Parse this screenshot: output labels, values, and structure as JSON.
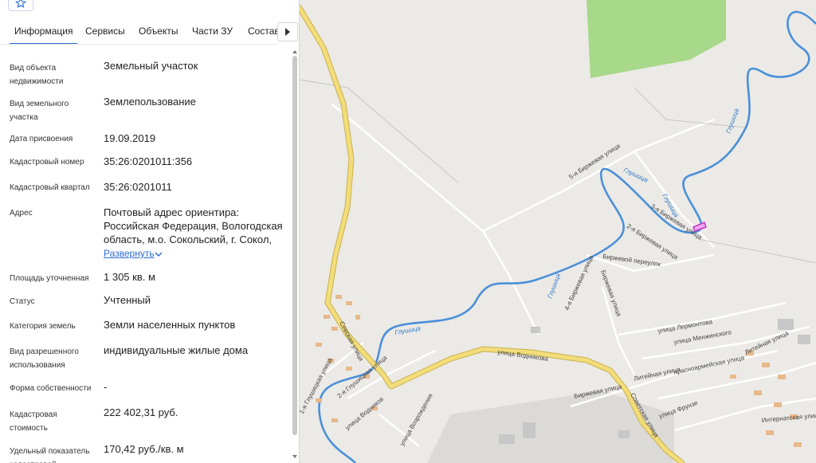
{
  "tabs": [
    "Информация",
    "Сервисы",
    "Объекты",
    "Части ЗУ",
    "Состав"
  ],
  "properties": [
    {
      "label": "Вид объекта недвижимости",
      "value": "Земельный участок"
    },
    {
      "label": "Вид земельного участка",
      "value": "Землепользование"
    },
    {
      "label": "Дата присвоения",
      "value": "19.09.2019"
    },
    {
      "label": "Кадастровый номер",
      "value": "35:26:0201011:356"
    },
    {
      "label": "Кадастровый квартал",
      "value": "35:26:0201011"
    },
    {
      "label": "Адрес",
      "value": "Почтовый адрес ориентира: Российская Федерация, Вологодская область, м.о. Сокольский, г. Сокол,"
    },
    {
      "label": "Площадь уточненная",
      "value": "1 305 кв. м"
    },
    {
      "label": "Статус",
      "value": "Учтенный"
    },
    {
      "label": "Категория земель",
      "value": "Земли населенных пунктов"
    },
    {
      "label": "Вид разрешенного использования",
      "value": "индивидуальные жилые дома"
    },
    {
      "label": "Форма собственности",
      "value": "-"
    },
    {
      "label": "Кадастровая стоимость",
      "value": "222 402,31 руб."
    },
    {
      "label": "Удельный показатель кадастровой",
      "value": "170,42 руб./кв. м"
    }
  ],
  "address_expand": "Развернуть",
  "map": {
    "streets": {
      "vodnikov": "улица Водникова",
      "sovetskaya": "Советская улица",
      "sevskaya": "Севская улица",
      "birzhevaya5": "5-я Биржевая улица",
      "birzhevaya3": "3-я Биржевая улица",
      "birzhevaya2": "2-я Биржевая улица",
      "birzhevaya4": "4-я Биржевая улица",
      "birzhevaya_ul": "Биржевая улица",
      "birzhevaya_ul2": "Биржевая улица",
      "birzhevoy_per": "Биржевой переулок",
      "lermontova": "улица Лермонтова",
      "menzhinskogo": "улица Менжинского",
      "krasnoarmeyskaya": "Красноармейская улица",
      "liteynaya": "Литейная улица",
      "liteynaya2": "Литейная улица",
      "frunze": "улица Фрунзе",
      "internatskaya": "Интернатская улица",
      "glushitskaya1": "1-я Глушицкая улица",
      "glushitskaya2": "2-я Глушицкая улица",
      "vodnikov2": "улица Водников",
      "vozrozhdeniya": "улица Возрождения"
    },
    "river": "Глушица",
    "colors": {
      "forest": "#a8d88a",
      "road": "#f2dd7a",
      "river": "#4a90d9",
      "parcel": "#c23bc2"
    }
  }
}
